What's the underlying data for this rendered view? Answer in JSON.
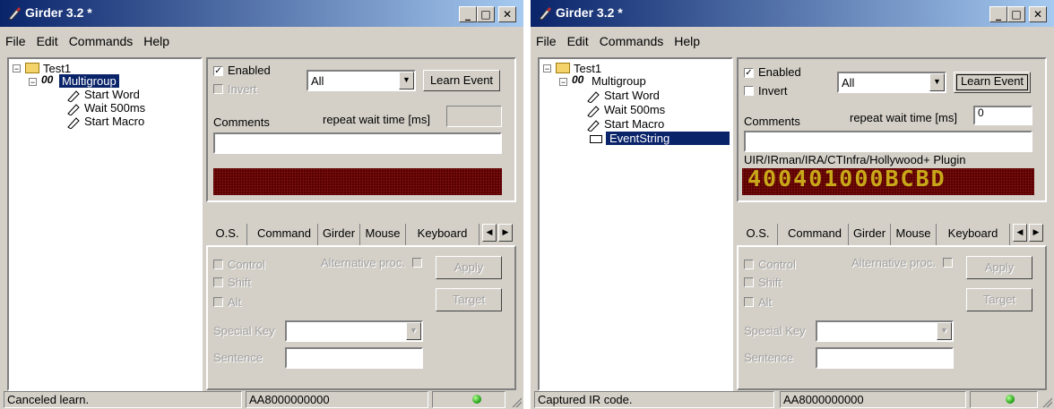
{
  "colors": {
    "titlebar": "#0a246a",
    "led_bg": "#5a0000",
    "led_text": "#c8a818",
    "status_light": "#1a9a10"
  },
  "windows": [
    {
      "title": "Girder 3.2 *",
      "menu": [
        "File",
        "Edit",
        "Commands",
        "Help"
      ],
      "tree": {
        "root": "Test1",
        "group": "Multigroup",
        "items": [
          "Start Word",
          "Wait 500ms",
          "Start Macro"
        ],
        "event": ""
      },
      "enabled_label": "Enabled",
      "invert_label": "Invert",
      "device_select": "All",
      "learn_label": "Learn Event",
      "comments_label": "Comments",
      "repeat_label": "repeat wait time [ms]",
      "repeat_value": "",
      "comments_value": "",
      "plugin_label": "",
      "led_value": "",
      "tabs": [
        "O.S.",
        "Command",
        "Girder",
        "Mouse",
        "Keyboard"
      ],
      "control_label": "Control",
      "shift_label": "Shift",
      "alt_label": "Alt",
      "altproc_label": "Alternative proc.",
      "apply_label": "Apply",
      "target_label": "Target",
      "special_key_label": "Special Key",
      "sentence_label": "Sentence",
      "status_text": "Canceled learn.",
      "status_code": "AA8000000000"
    },
    {
      "title": "Girder 3.2 *",
      "menu": [
        "File",
        "Edit",
        "Commands",
        "Help"
      ],
      "tree": {
        "root": "Test1",
        "group": "Multigroup",
        "items": [
          "Start Word",
          "Wait 500ms",
          "Start Macro"
        ],
        "event": "EventString"
      },
      "enabled_label": "Enabled",
      "invert_label": "Invert",
      "device_select": "All",
      "learn_label": "Learn Event",
      "comments_label": "Comments",
      "repeat_label": "repeat wait time [ms]",
      "repeat_value": "0",
      "comments_value": "",
      "plugin_label": "UIR/IRman/IRA/CTInfra/Hollywood+ Plugin",
      "led_value": "400401000BCBD",
      "tabs": [
        "O.S.",
        "Command",
        "Girder",
        "Mouse",
        "Keyboard"
      ],
      "control_label": "Control",
      "shift_label": "Shift",
      "alt_label": "Alt",
      "altproc_label": "Alternative proc.",
      "apply_label": "Apply",
      "target_label": "Target",
      "special_key_label": "Special Key",
      "sentence_label": "Sentence",
      "status_text": "Captured IR code.",
      "status_code": "AA8000000000"
    }
  ]
}
